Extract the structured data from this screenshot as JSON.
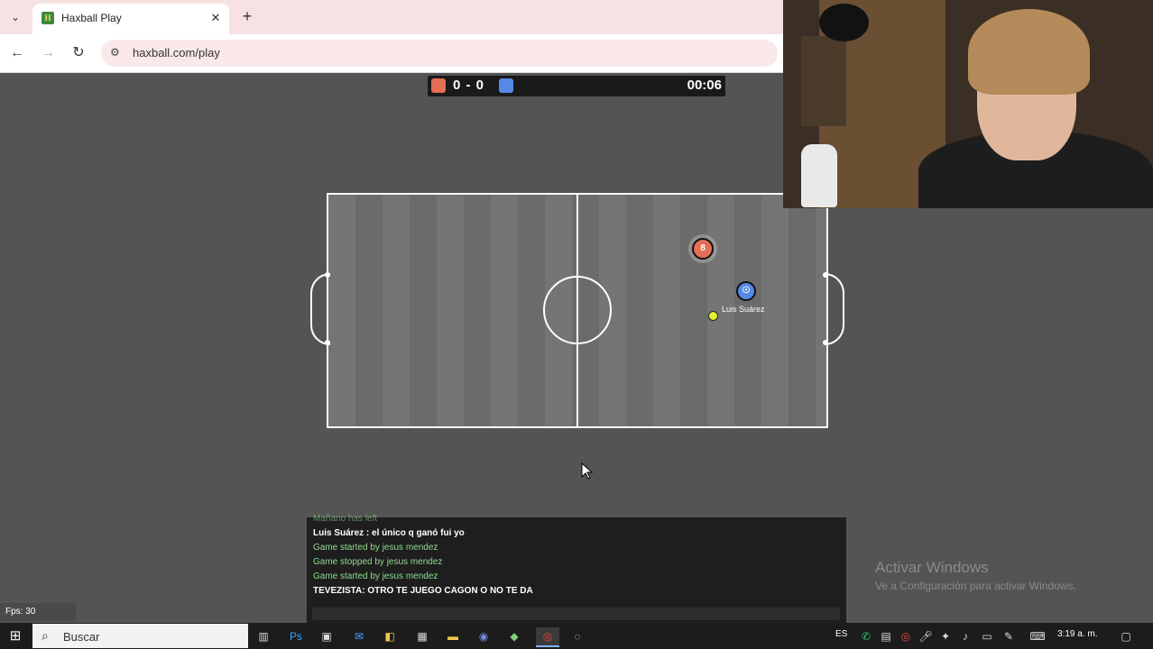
{
  "browser": {
    "tab_title": "Haxball Play",
    "url": "haxball.com/play"
  },
  "game": {
    "score": "0 - 0",
    "timer": "00:06",
    "red_player_number": "8",
    "blue_player_label": "☉",
    "player_name": "Luis Suárez",
    "colors": {
      "red": "#e56e56",
      "blue": "#5689e5",
      "ball": "#e4f230"
    }
  },
  "chat": {
    "lines": [
      {
        "text": "Mañano has left",
        "color": "#8fd98f"
      },
      {
        "text": "Luis Suárez : el único q ganó fui yo",
        "color": "#ffffff"
      },
      {
        "text": "Game started by jesus mendez",
        "color": "#8fd98f"
      },
      {
        "text": "Game stopped by jesus mendez",
        "color": "#8fd98f"
      },
      {
        "text": "Game started by jesus mendez",
        "color": "#8fd98f"
      },
      {
        "text": "TEVEZISTA: OTRO TE JUEGO CAGON O NO TE DA",
        "color": "#ffffff"
      }
    ]
  },
  "fps": "Fps: 30",
  "windows_activation": {
    "title": "Activar Windows",
    "subtitle": "Ve a Configuración para activar Windows."
  },
  "taskbar": {
    "search_placeholder": "Buscar",
    "language": "ES",
    "time": "3:19 a. m."
  }
}
